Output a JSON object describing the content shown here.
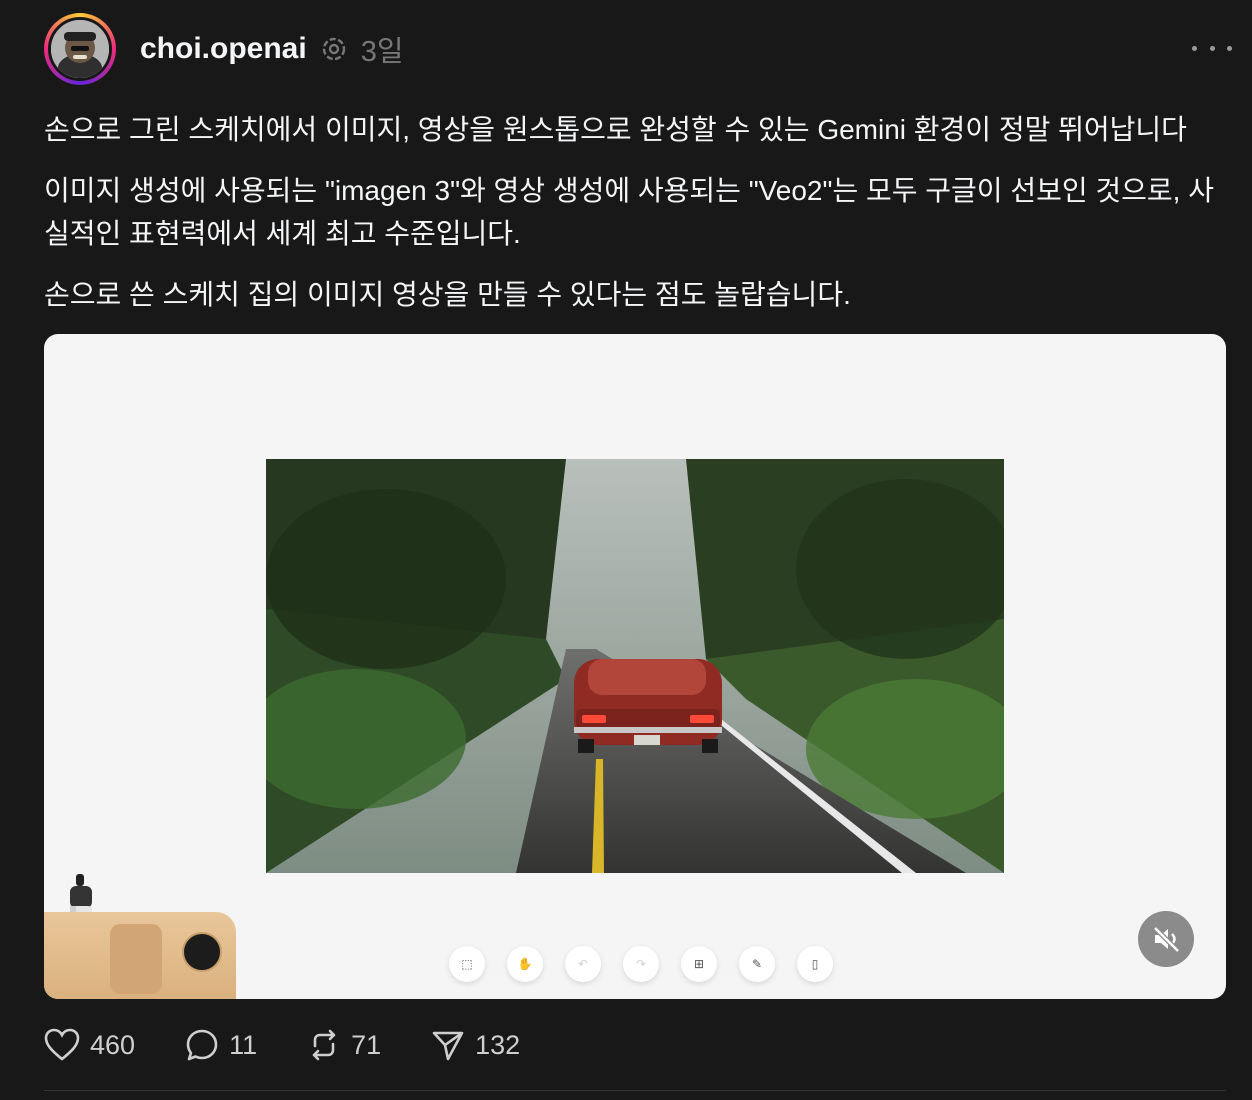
{
  "post": {
    "username": "choi.openai",
    "time": "3일",
    "paragraphs": [
      "손으로 그린 스케치에서 이미지, 영상을 원스톱으로 완성할 수 있는 Gemini 환경이 정말 뛰어납니다",
      "이미지 생성에 사용되는 \"imagen 3\"와 영상 생성에 사용되는 \"Veo2\"는 모두 구글이 선보인 것으로, 사실적인 표현력에서 세계 최고 수준입니다.",
      "손으로 쓴 스케치 집의 이미지 영상을 만들 수 있다는 점도 놀랍습니다."
    ]
  },
  "media": {
    "type": "video",
    "muted": true,
    "toolbar_icons": [
      "select-icon",
      "hand-icon",
      "undo-icon",
      "redo-icon",
      "add-image-icon",
      "edit-icon",
      "delete-icon"
    ]
  },
  "actions": {
    "likes": "460",
    "replies": "11",
    "reposts": "71",
    "shares": "132"
  },
  "colors": {
    "background": "#181818",
    "text": "#f3f5f7",
    "muted": "#777777"
  }
}
